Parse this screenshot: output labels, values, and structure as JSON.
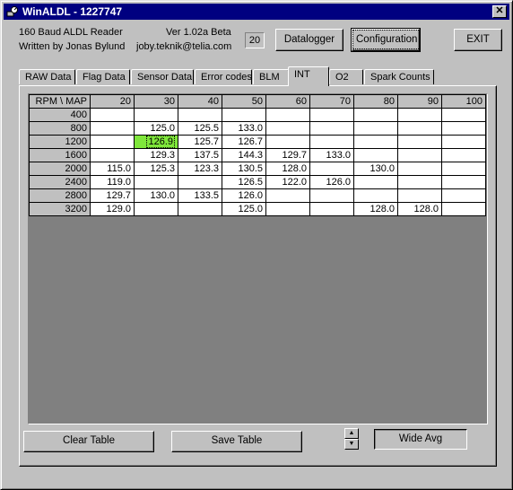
{
  "window": {
    "title": "WinALDL - 1227747",
    "close_glyph": "✕"
  },
  "header": {
    "app_line1": "160 Baud ALDL Reader",
    "app_line2": "Written by Jonas Bylund",
    "version": "Ver 1.02a Beta",
    "email": "joby.teknik@telia.com",
    "counter": "20",
    "datalogger_label": "Datalogger",
    "configuration_label": "Configuration",
    "exit_label": "EXIT"
  },
  "tabs": [
    "RAW Data",
    "Flag Data",
    "Sensor Data",
    "Error codes",
    "BLM",
    "INT",
    "O2",
    "Spark Counts"
  ],
  "active_tab": "INT",
  "grid": {
    "corner": "RPM \\ MAP",
    "map_headers": [
      "20",
      "30",
      "40",
      "50",
      "60",
      "70",
      "80",
      "90",
      "100"
    ],
    "rows": [
      {
        "rpm": "400",
        "cells": [
          "",
          "",
          "",
          "",
          "",
          "",
          "",
          "",
          ""
        ]
      },
      {
        "rpm": "800",
        "cells": [
          "",
          "125.0",
          "125.5",
          "133.0",
          "",
          "",
          "",
          "",
          ""
        ]
      },
      {
        "rpm": "1200",
        "cells": [
          "",
          "126.9",
          "125.7",
          "126.7",
          "",
          "",
          "",
          "",
          ""
        ]
      },
      {
        "rpm": "1600",
        "cells": [
          "",
          "129.3",
          "137.5",
          "144.3",
          "129.7",
          "133.0",
          "",
          "",
          ""
        ]
      },
      {
        "rpm": "2000",
        "cells": [
          "115.0",
          "125.3",
          "123.3",
          "130.5",
          "128.0",
          "",
          "130.0",
          "",
          ""
        ]
      },
      {
        "rpm": "2400",
        "cells": [
          "119.0",
          "",
          "",
          "126.5",
          "122.0",
          "126.0",
          "",
          "",
          ""
        ]
      },
      {
        "rpm": "2800",
        "cells": [
          "129.7",
          "130.0",
          "133.5",
          "126.0",
          "",
          "",
          "",
          "",
          ""
        ]
      },
      {
        "rpm": "3200",
        "cells": [
          "129.0",
          "",
          "",
          "125.0",
          "",
          "",
          "128.0",
          "128.0",
          ""
        ]
      }
    ],
    "selected_cell": {
      "row": 2,
      "col": 1
    },
    "selected_color": "#7fe63b"
  },
  "footer": {
    "clear_label": "Clear Table",
    "save_label": "Save Table",
    "wide_avg_label": "Wide Avg",
    "spin_up": "▲",
    "spin_down": "▼"
  }
}
